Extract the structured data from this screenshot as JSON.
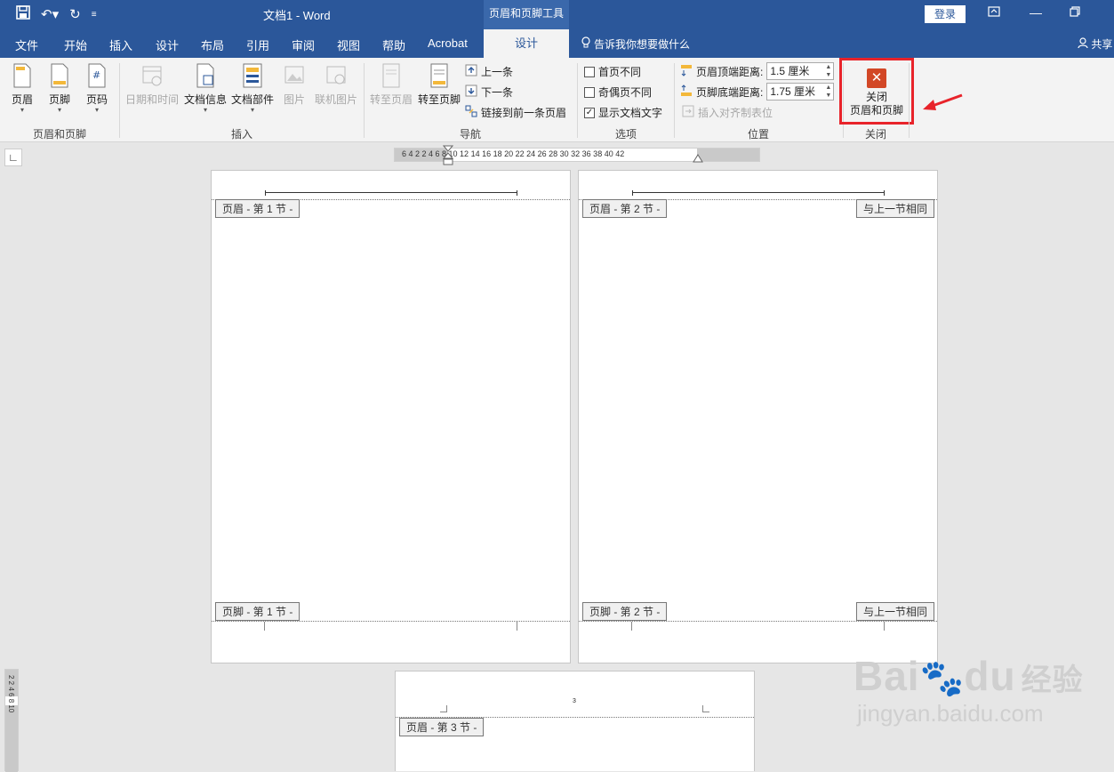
{
  "titlebar": {
    "doc_title": "文档1  -  Word",
    "context_tool": "页眉和页脚工具",
    "login": "登录"
  },
  "tabs": [
    {
      "label": "文件"
    },
    {
      "label": "开始"
    },
    {
      "label": "插入"
    },
    {
      "label": "设计"
    },
    {
      "label": "布局"
    },
    {
      "label": "引用"
    },
    {
      "label": "审阅"
    },
    {
      "label": "视图"
    },
    {
      "label": "帮助"
    },
    {
      "label": "Acrobat"
    },
    {
      "label": "设计"
    }
  ],
  "tellme": "告诉我你想要做什么",
  "share": "共享",
  "ribbon": {
    "group_hf": {
      "label": "页眉和页脚",
      "header": "页眉",
      "footer": "页脚",
      "page_number": "页码"
    },
    "group_insert": {
      "label": "插入",
      "date_time": "日期和时间",
      "doc_info": "文档信息",
      "doc_parts": "文档部件",
      "picture": "图片",
      "online_picture": "联机图片"
    },
    "group_nav": {
      "label": "导航",
      "goto_header": "转至页眉",
      "goto_footer": "转至页脚",
      "previous": "上一条",
      "next": "下一条",
      "link_previous": "链接到前一条页眉"
    },
    "group_options": {
      "label": "选项",
      "different_first": "首页不同",
      "different_odd_even": "奇偶页不同",
      "show_doc_text": "显示文档文字"
    },
    "group_position": {
      "label": "位置",
      "header_top_label": "页眉顶端距离:",
      "header_top_value": "1.5 厘米",
      "footer_bottom_label": "页脚底端距离:",
      "footer_bottom_value": "1.75 厘米",
      "insert_align_tab": "插入对齐制表位"
    },
    "group_close": {
      "label": "关闭",
      "close_line1": "关闭",
      "close_line2": "页眉和页脚"
    }
  },
  "ruler": {
    "numbers": "6   4   2         2   4   6   8  10  12  14  16  18  20  22  24  26  28  30  32       36  38  40  42",
    "vertical_numbers": "2   2  4  6  8  10"
  },
  "pages": {
    "page1_header_tag": "页眉 - 第 1 节 -",
    "page1_footer_tag": "页脚 - 第 1 节 -",
    "page2_header_tag": "页眉 - 第 2 节 -",
    "page2_footer_tag": "页脚 - 第 2 节 -",
    "same_as_previous": "与上一节相同",
    "page3_number": "3",
    "page3_header_tag": "页眉 - 第 3 节 -"
  },
  "watermark": {
    "brand": "Bai",
    "brand2": "du",
    "cn": "经验",
    "url": "jingyan.baidu.com"
  },
  "colors": {
    "title_blue": "#2b579a",
    "close_red": "#d24726",
    "highlight_red": "#e8232a"
  }
}
